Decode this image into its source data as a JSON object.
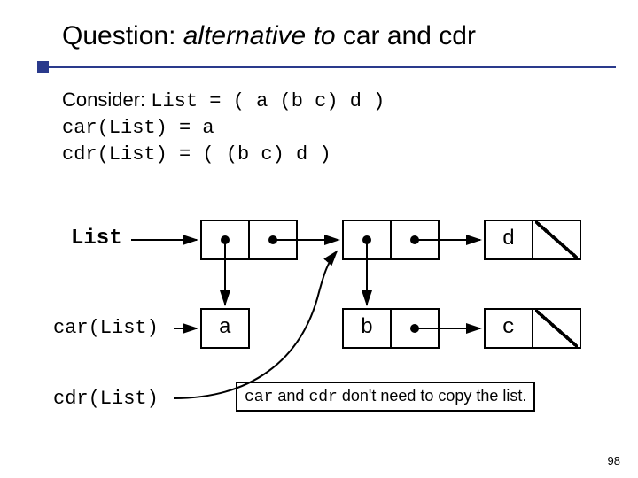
{
  "title": {
    "lead": "Question: ",
    "italic": "alternative to",
    "tail": " car and cdr"
  },
  "consider": {
    "prefix": "Consider: ",
    "line1_code": "List = ( a (b c) d )",
    "line2": "car(List) = a",
    "line3": "cdr(List) = ( (b c) d )"
  },
  "labels": {
    "list": "List",
    "car": "car(List)",
    "cdr": "cdr(List)"
  },
  "nodes": {
    "a": "a",
    "b": "b",
    "c": "c",
    "d": "d"
  },
  "note": {
    "p1": "car",
    "p2": " and ",
    "p3": "cdr",
    "p4": " don't need to copy the list."
  },
  "page": "98"
}
